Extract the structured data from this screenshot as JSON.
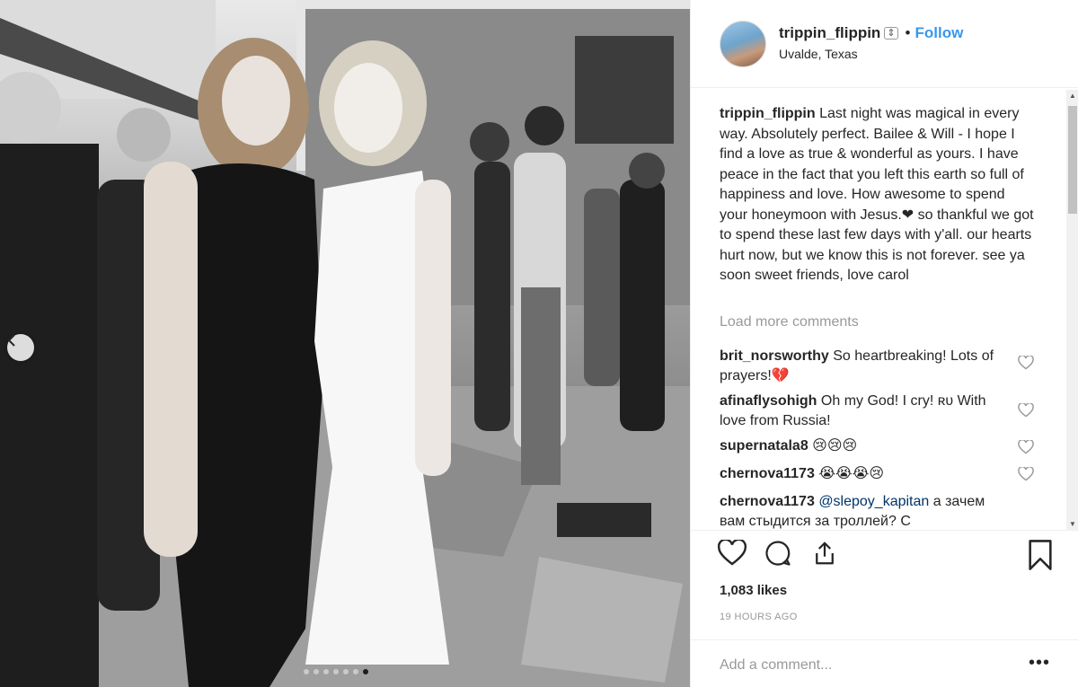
{
  "post": {
    "username": "trippin_flippin",
    "follow_label": "Follow",
    "separator": "•",
    "location": "Uvalde, Texas",
    "caption_user": "trippin_flippin",
    "caption_text": "Last night was magical in every way. Absolutely perfect. Bailee & Will - I hope I find a love as true & wonderful as yours. I have peace in the fact that you left this earth so full of happiness and love. How awesome to spend your honeymoon with Jesus.❤ so thankful we got to spend these last few days with y'all. our hearts hurt now, but we know this is not forever. see ya soon sweet friends, love carol",
    "load_more_label": "Load more comments",
    "likes": "1,083 likes",
    "timestamp": "19 HOURS AGO",
    "add_comment_placeholder": "Add a comment...",
    "more_label": "•••"
  },
  "comments": [
    {
      "user": "brit_norsworthy",
      "text": "So heartbreaking! Lots of prayers!💔"
    },
    {
      "user": "afinaflysohigh",
      "text": "Oh my God! I cry! ʀᴜ With love from Russia!"
    },
    {
      "user": "supernatala8",
      "text": "😢😢😢"
    },
    {
      "user": "chernova1173",
      "text": "😭😭😭😢"
    },
    {
      "user": "chernova1173",
      "mention": "@slepoy_kapitan",
      "text": "а зачем вам стыдится за троллей? С"
    }
  ],
  "carousel": {
    "dot_count": 7,
    "active_index": 6
  },
  "icons": {
    "like": "heart-icon",
    "comment": "comment-bubble-icon",
    "share": "share-icon",
    "save": "bookmark-icon",
    "prev": "chevron-left-icon"
  },
  "colors": {
    "accent": "#3897f0",
    "text": "#262626",
    "muted": "#999999"
  }
}
